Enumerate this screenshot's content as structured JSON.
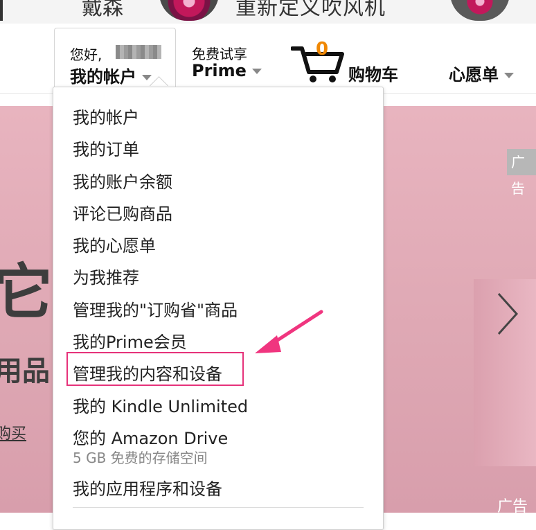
{
  "promo": {
    "text_left": "戴森",
    "text_right": "重新定义吹风机"
  },
  "nav": {
    "account": {
      "greeting": "您好,",
      "label": "我的帐户"
    },
    "prime": {
      "small": "免费试享",
      "big": "Prime"
    },
    "cart": {
      "count": "0",
      "label": "购物车"
    },
    "wishlist": {
      "label": "心愿单"
    }
  },
  "dropdown": {
    "items": [
      {
        "label": "我的帐户"
      },
      {
        "label": "我的订单"
      },
      {
        "label": "我的账户余额"
      },
      {
        "label": "评论已购商品"
      },
      {
        "label": "我的心愿单"
      },
      {
        "label": "为我推荐"
      },
      {
        "label": "管理我的\"订购省\"商品"
      },
      {
        "label": "我的Prime会员"
      },
      {
        "label": "管理我的内容和设备"
      },
      {
        "label": "我的 Kindle Unlimited"
      },
      {
        "label": "您的 Amazon Drive",
        "sub": "5 GB 免费的存储空间"
      },
      {
        "label": "我的应用程序和设备"
      }
    ]
  },
  "hero": {
    "big_text": "它",
    "mid_text": "用品",
    "link_text": "购买",
    "ad_tag": "广告",
    "ad_tag_bottom": "广告"
  },
  "colors": {
    "cart_count": "#f08804",
    "highlight": "#e6327a",
    "hero_bg": "#e2adb8"
  },
  "icons": [
    "cart-icon",
    "chevron-down-icon",
    "chevron-right-icon",
    "pointer-arrow-icon"
  ]
}
